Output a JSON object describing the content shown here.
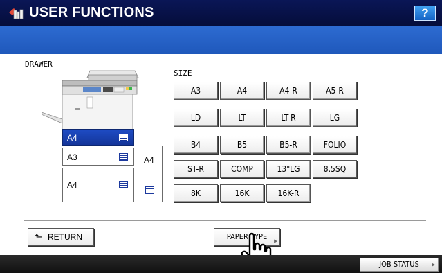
{
  "header": {
    "title": "USER FUNCTIONS",
    "help_label": "?"
  },
  "drawer_section": {
    "label": "DRAWER",
    "drawers": [
      {
        "paper": "A4",
        "selected": true
      },
      {
        "paper": "A3",
        "selected": false
      },
      {
        "paper": "A4",
        "selected": false
      }
    ],
    "bypass": {
      "paper": "A4"
    }
  },
  "size_section": {
    "label": "SIZE",
    "buttons": [
      [
        "A3",
        "A4",
        "A4-R",
        "A5-R"
      ],
      [
        "LD",
        "LT",
        "LT-R",
        "LG"
      ],
      [
        "B4",
        "B5",
        "B5-R",
        "FOLIO"
      ],
      [
        "ST-R",
        "COMP",
        "13\"LG",
        "8.5SQ"
      ],
      [
        "8K",
        "16K",
        "16K-R"
      ]
    ]
  },
  "footer": {
    "return_label": "RETURN",
    "return_icon": "up-left-arrow-icon",
    "paper_type_label": "PAPER TYPE",
    "job_status_label": "JOB STATUS"
  },
  "colors": {
    "title_bar": "#0a1656",
    "blue_band": "#2566cc",
    "selected_drawer": "#1e4cc4",
    "help_button": "#2a86e0",
    "bottom_bar": "#1a1a1a"
  }
}
